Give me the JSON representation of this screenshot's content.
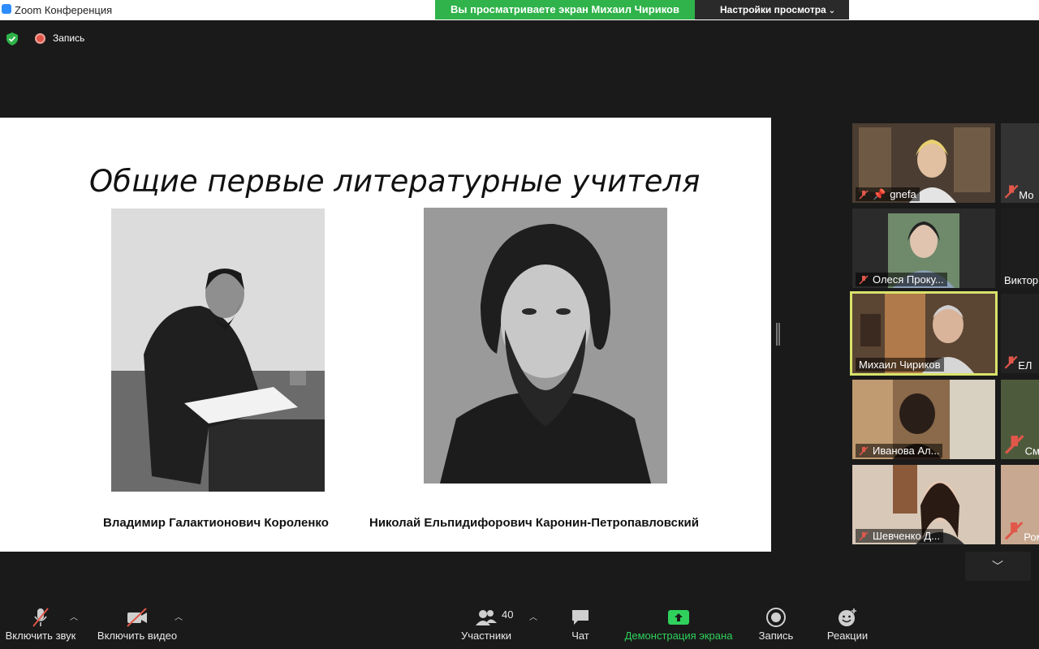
{
  "titlebar": {
    "app_title": "Zoom Конференция"
  },
  "share_banner": {
    "text": "Вы просматриваете экран Михаил Чириков"
  },
  "view_options": {
    "label": "Настройки просмотра"
  },
  "status": {
    "recording_label": "Запись"
  },
  "slide": {
    "title": "Общие первые литературные учителя",
    "caption_left": "Владимир Галактионович Короленко",
    "caption_right": "Николай Ельпидифорович Каронин-Петропавловский"
  },
  "participants": [
    {
      "name": "gnefa",
      "muted": true,
      "pinned": true
    },
    {
      "name": "Олеся Проку...",
      "muted": true
    },
    {
      "name": "Михаил Чириков",
      "muted": false,
      "active": true
    },
    {
      "name": "Иванова Ал...",
      "muted": true
    },
    {
      "name": "Шевченко Д...",
      "muted": true
    }
  ],
  "participants_right_column": [
    {
      "name": "Мо"
    },
    {
      "name": "Виктор"
    },
    {
      "name": "ЕЛ"
    },
    {
      "name": "Сми"
    },
    {
      "name": "Ром"
    }
  ],
  "toolbar": {
    "unmute_label": "Включить звук",
    "video_label": "Включить видео",
    "participants_label": "Участники",
    "participants_count": "40",
    "chat_label": "Чат",
    "share_label": "Демонстрация экрана",
    "record_label": "Запись",
    "reactions_label": "Реакции"
  },
  "colors": {
    "share_green": "#2fb34a",
    "active_speaker": "#d8e36a",
    "muted_red": "#e0574a"
  }
}
